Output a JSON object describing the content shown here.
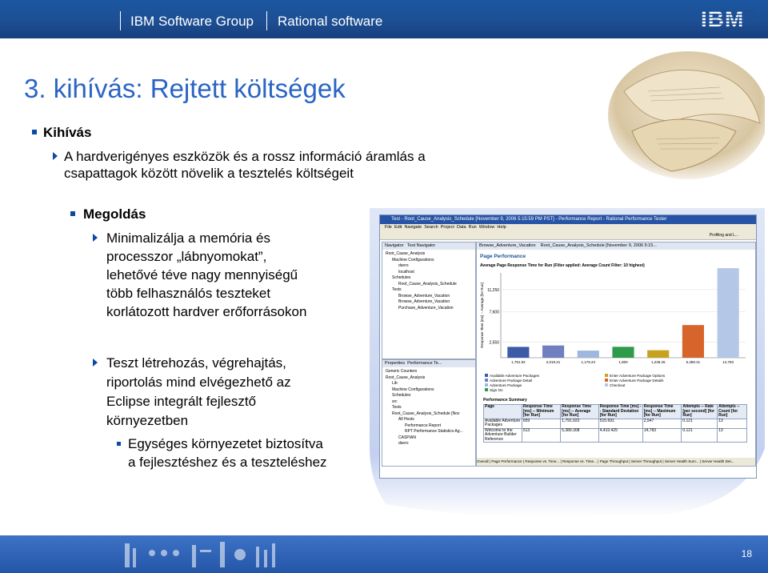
{
  "header": {
    "group": "IBM Software Group",
    "product": "Rational software",
    "logo": "IBM"
  },
  "title": "3. kihívás: Rejtett költségek",
  "sections": [
    {
      "heading": "Kihívás",
      "items": [
        {
          "lines": [
            "A hardverigényes eszközök és a rossz információ áramlás a",
            "csapattagok között növelik a tesztelés költségeit"
          ]
        }
      ]
    },
    {
      "heading": "Megoldás",
      "items": [
        {
          "lines": [
            "Minimalizálja a memória és",
            "processzor „lábnyomokat”,",
            "lehetővé téve nagy mennyiségű",
            "több felhasználós teszteket",
            "korlátozott hardver erőforrásokon"
          ]
        },
        {
          "lines": [
            "Teszt létrehozás, végrehajtás,",
            "riportolás mind elvégezhető az",
            "Eclipse integrált fejlesztő",
            "környezetben"
          ]
        }
      ],
      "subitem": {
        "lines": [
          "Egységes környezetet biztosítva",
          "a fejlesztéshez és a teszteléshez"
        ]
      }
    }
  ],
  "screenshot": {
    "window_title": "Test - Root_Cause_Analysis_Schedule [November 9, 2006 5:15:59 PM PST] - Performance Report - Rational Performance Tester",
    "menu": [
      "File",
      "Edit",
      "Navigate",
      "Search",
      "Project",
      "Data",
      "Run",
      "Window",
      "Help"
    ],
    "perspective": "Profiling and L...",
    "tabs": {
      "left": [
        "Navigator",
        "Test Navigator"
      ],
      "editor": [
        "Browse_Adventure_Vacation",
        "Root_Cause_Analysis_Schedule [November 9, 2006 5:15..."
      ]
    },
    "tree": [
      "Root_Cause_Analysis",
      "Machine Configurations",
      "dsero",
      "localhost",
      "Schedules",
      "Root_Cause_Analysis_Schedule",
      "Tests",
      "Browse_Adventure_Vacation",
      "Browse_Adventure_Vacation",
      "Purchase_Adventure_Vacation"
    ],
    "props_tabs": [
      "Properties",
      "Performance Te..."
    ],
    "tree2": [
      "Generic Counters",
      "Root_Cause_Analysis",
      "Lib",
      "Machine Configurations",
      "Schedules",
      "src",
      "Tests",
      "Root_Cause_Analysis_Schedule [Nov",
      "All Hosts",
      "Performance Report",
      "RPT Performance Statistics Ag...",
      "CASPIAN",
      "dsero"
    ],
    "page_title": "Page Performance",
    "chart_caption": "Average Page Response Time for Run (Filter applied: Average Count Filter: 10 highest)",
    "legend": [
      "Available Adventure Packages",
      "Adventure Package Detail",
      "Adventure Package",
      "Sign On",
      "Enter Adventure Package Options",
      "Enter Adventure Package Details",
      "Checkout"
    ],
    "summary_title": "Performance Summary",
    "summary_headers": [
      "Page",
      "Response Time [ms] -- Minimum [for Run]",
      "Response Time [ms] -- Average [for Run]",
      "Response Time [ms] -- Standard Deviation [for Run]",
      "Response Time [ms] -- Maximum [for Run]",
      "Attempts -- Rate [per second] [for Run]",
      "Attempts -- Count [for Run]"
    ],
    "summary_rows": [
      [
        "Available Adventure Packages",
        "659",
        "1,791.922",
        "515.691",
        "2,547",
        "0.121",
        "13"
      ],
      [
        "Welcome to the Adventure Builder Reference",
        "513",
        "5,389.308",
        "4,410.425",
        "14,783",
        "0.121",
        "13"
      ]
    ],
    "bottom_tabs": [
      "Overall",
      "Page Performance",
      "Response vs. Time...",
      "Response vs. Time...",
      "Page Throughput",
      "Server Throughput",
      "Server Health Sum...",
      "Server Health Det..."
    ],
    "page_number": "18"
  },
  "chart_data": {
    "type": "bar",
    "title": "Average Page Response Time for Run (Filter applied: Average Count Filter: 10 highest)",
    "ylabel": "Response Time [ms] -- Average [for Run]",
    "xlabel": "",
    "ylim": [
      0,
      14000
    ],
    "yticks": [
      "2,550",
      "7,600",
      "11,250"
    ],
    "categories": [
      "Available Adventure Packages",
      "Adventure Package Detail",
      "Adventure Package",
      "Sign On",
      "Enter Adventure Package Options",
      "Enter Adventure Package Details",
      "Checkout"
    ],
    "values": [
      1791.922,
      2019.21,
      1179.23,
      1800,
      1236.26,
      5389.308,
      14783
    ],
    "labels": [
      "1,791.92",
      "2,019.21",
      "1,179.23",
      "1,800",
      "1,236.26",
      "5,389.31",
      "14,783"
    ],
    "colors": [
      "#3c5aa6",
      "#6f7fbf",
      "#9fb7e0",
      "#2d9b4a",
      "#c7a21d",
      "#d7642a",
      "#b4c7e7"
    ]
  }
}
